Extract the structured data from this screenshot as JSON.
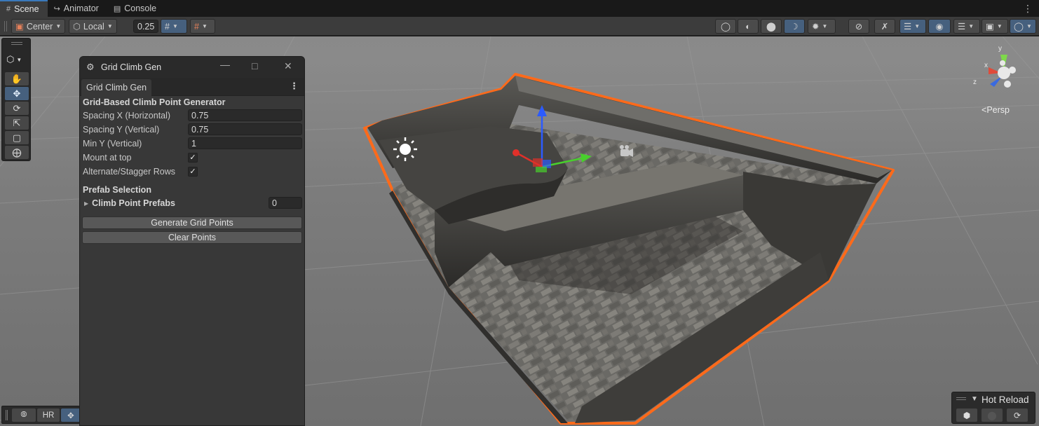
{
  "tabs": [
    {
      "label": "Scene",
      "icon": "grid-icon",
      "active": true
    },
    {
      "label": "Animator",
      "icon": "animator-icon",
      "active": false
    },
    {
      "label": "Console",
      "icon": "console-icon",
      "active": false
    }
  ],
  "toolbar": {
    "pivot_mode": "Center",
    "pivot_rotation": "Local",
    "snap_increment": "0.25"
  },
  "scene": {
    "projection_label": "Persp",
    "gizmo_axes": {
      "y": "y",
      "x": "x",
      "z": "z"
    }
  },
  "window": {
    "title": "Grid Climb Gen",
    "tab_label": "Grid Climb Gen",
    "header": "Grid-Based Climb Point Generator",
    "fields": {
      "spacing_x_label": "Spacing X (Horizontal)",
      "spacing_x_value": "0.75",
      "spacing_y_label": "Spacing Y (Vertical)",
      "spacing_y_value": "0.75",
      "min_y_label": "Min Y (Vertical)",
      "min_y_value": "1",
      "mount_label": "Mount at top",
      "mount_checked": true,
      "alternate_label": "Alternate/Stagger Rows",
      "alternate_checked": true
    },
    "prefab_section": "Prefab Selection",
    "prefab_foldout": "Climb Point Prefabs",
    "prefab_count": "0",
    "generate_button": "Generate Grid Points",
    "clear_button": "Clear Points"
  },
  "bottom_overlay": {
    "hr_label": "HR"
  },
  "hot_reload": {
    "title": "Hot Reload"
  },
  "colors": {
    "accent_blue": "#46607e",
    "selection_outline": "#ff6a1a",
    "background_dark": "#383838"
  }
}
